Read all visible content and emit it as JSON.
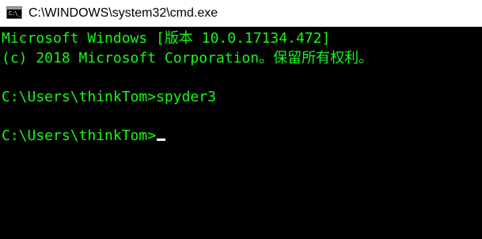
{
  "window": {
    "title": "C:\\WINDOWS\\system32\\cmd.exe",
    "icon": "cmd-icon",
    "icon_glyph": "C:\\_"
  },
  "console": {
    "text_color": "#16f916",
    "background_color": "#000000",
    "lines": [
      "Microsoft Windows [版本 10.0.17134.472]",
      "(c) 2018 Microsoft Corporation。保留所有权利。",
      "",
      "C:\\Users\\thinkTom>spyder3",
      "",
      "C:\\Users\\thinkTom>"
    ]
  }
}
